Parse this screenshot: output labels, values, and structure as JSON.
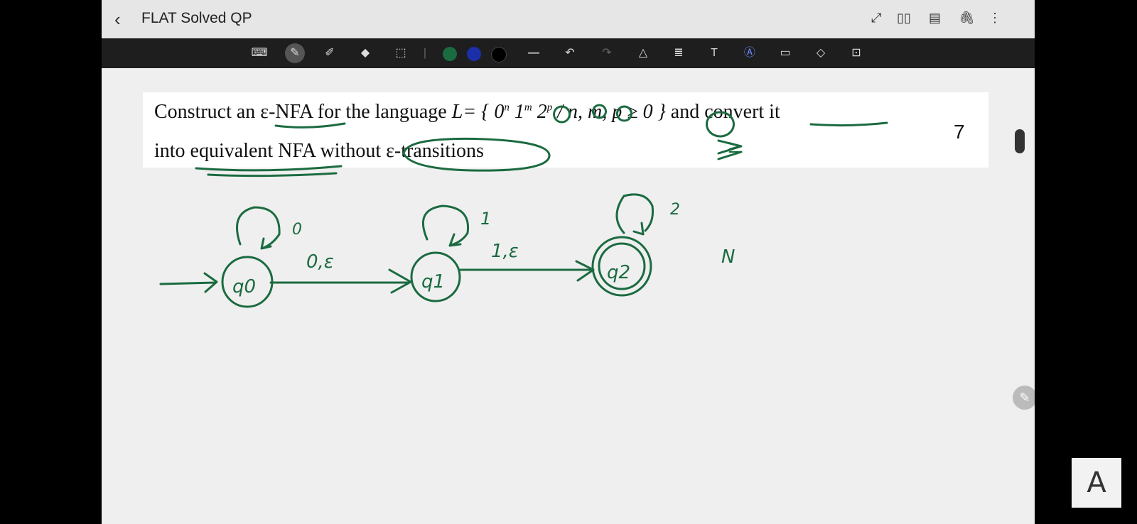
{
  "app": {
    "title": "FLAT Solved QP",
    "back_icon": "chevron-left-icon",
    "header_icons": [
      "expand-icon",
      "book-view-icon",
      "page-icon",
      "attach-icon",
      "more-icon"
    ]
  },
  "toolbar": {
    "tools": [
      "keyboard-icon",
      "pen-icon",
      "highlighter-icon",
      "eraser-icon",
      "lasso-select-icon",
      "undo-icon",
      "redo-icon",
      "shape-icon",
      "text-format-icon",
      "text-size-icon",
      "handwriting-icon",
      "text-box-icon",
      "shapes-icon",
      "lock-icon"
    ],
    "colors": [
      "#1b6b40",
      "#1a2fa8",
      "#000000"
    ],
    "active_color": "#1b6b40"
  },
  "question": {
    "line1_pre": "Construct an ε-NFA for the language ",
    "line1_lang": "L= { 0",
    "sup_n": "n",
    "one": " 1",
    "sup_m": "m",
    "two": " 2",
    "sup_p": "p",
    "cond": " / n, m, p ≥ 0 }",
    "line1_post": " and convert it",
    "line2": "into equivalent NFA without ε-transitions",
    "marks": "7"
  },
  "diagram": {
    "ink_color": "#1b6b40",
    "states": [
      "q0",
      "q1",
      "q2"
    ],
    "self_loops": [
      "0",
      "1",
      "2"
    ],
    "transitions": [
      "0,ε",
      "1,ε"
    ],
    "annotations": [
      "≥",
      "N"
    ]
  },
  "fab": {
    "pencil_icon": "pencil-icon",
    "a_label": "A"
  }
}
